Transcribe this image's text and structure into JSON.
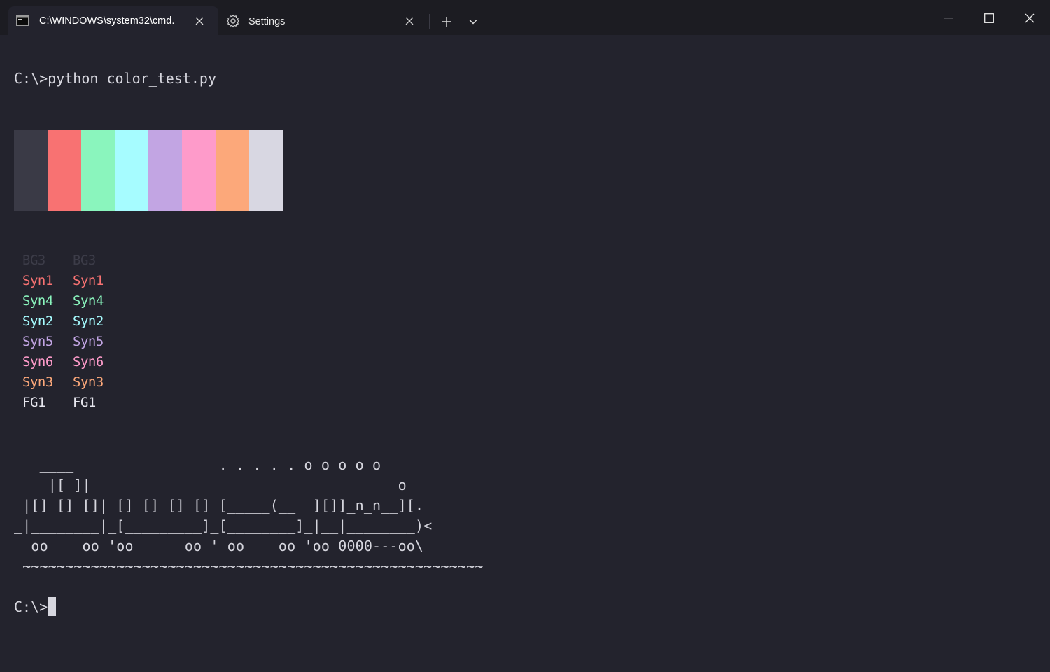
{
  "tabs": [
    {
      "label": "C:\\WINDOWS\\system32\\cmd."
    },
    {
      "label": "Settings"
    }
  ],
  "terminal": {
    "command_line": "C:\\>python color_test.py",
    "prompt": "C:\\>",
    "swatches": [
      "#3a3a46",
      "#f87272",
      "#8af5bd",
      "#a6fcff",
      "#c2a5e3",
      "#fe9bca",
      "#fca87a",
      "#d8d7e2"
    ],
    "color_rows": [
      {
        "a": "BG3",
        "b": "BG3",
        "color": "#3c3c48"
      },
      {
        "a": "Syn1",
        "b": "Syn1",
        "color": "#f87272"
      },
      {
        "a": "Syn4",
        "b": "Syn4",
        "color": "#8af5bd"
      },
      {
        "a": "Syn2",
        "b": "Syn2",
        "color": "#a6fcff"
      },
      {
        "a": "Syn5",
        "b": "Syn5",
        "color": "#c2a5e3"
      },
      {
        "a": "Syn6",
        "b": "Syn6",
        "color": "#fe9bca"
      },
      {
        "a": "Syn3",
        "b": "Syn3",
        "color": "#fca87a"
      },
      {
        "a": "FG1",
        "b": "FG1",
        "color": "#e6e6ee"
      }
    ],
    "ascii_art": "   ____                 . . . . . o o o o o\n  __|[_]|__ ___________ _______    ____      o\n |[] [] []| [] [] [] [] [_____(__  ][]]_n_n__][.\n_|________|_[_________]_[________]_|__|________)<\n  oo    oo 'oo      oo ' oo    oo 'oo 0000---oo\\_\n ~~~~~~~~~~~~~~~~~~~~~~~~~~~~~~~~~~~~~~~~~~~~~~~~~~~~~~"
  }
}
